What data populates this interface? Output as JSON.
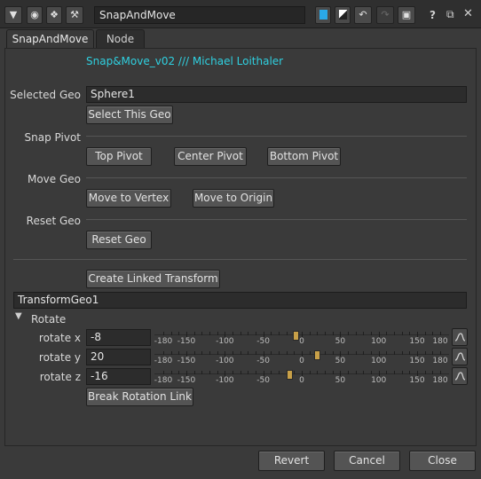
{
  "titlebar": {
    "node_name": "SnapAndMove",
    "help_glyph": "?"
  },
  "tabs": [
    {
      "label": "SnapAndMove"
    },
    {
      "label": "Node"
    }
  ],
  "credit": "Snap&Move_v02 /// Michael Loithaler",
  "selected_geo": {
    "label": "Selected Geo",
    "value": "Sphere1",
    "button": "Select This Geo"
  },
  "snap_pivot": {
    "label": "Snap Pivot",
    "buttons": [
      "Top Pivot",
      "Center Pivot",
      "Bottom Pivot"
    ]
  },
  "move_geo": {
    "label": "Move Geo",
    "buttons": [
      "Move to Vertex",
      "Move to Origin"
    ]
  },
  "reset_geo": {
    "label": "Reset Geo",
    "button": "Reset Geo"
  },
  "linked": {
    "button": "Create Linked Transform",
    "transform_name": "TransformGeo1"
  },
  "rotate": {
    "group_label": "Rotate",
    "rows": [
      {
        "label": "rotate x",
        "value": "-8",
        "level": -8
      },
      {
        "label": "rotate y",
        "value": "20",
        "level": 20
      },
      {
        "label": "rotate z",
        "value": "-16",
        "level": -16
      }
    ],
    "scale_labels": [
      "-180",
      "-150",
      "-100",
      "-50",
      "0",
      "50",
      "100",
      "150",
      "180"
    ],
    "scale_values": [
      -180,
      -150,
      -100,
      -50,
      0,
      50,
      100,
      150,
      180
    ],
    "break_button": "Break Rotation Link"
  },
  "footer": {
    "revert": "Revert",
    "cancel": "Cancel",
    "close": "Close"
  },
  "colors": {
    "accent_cyan": "#2fd0e0",
    "slider_knob": "#c8a048"
  }
}
